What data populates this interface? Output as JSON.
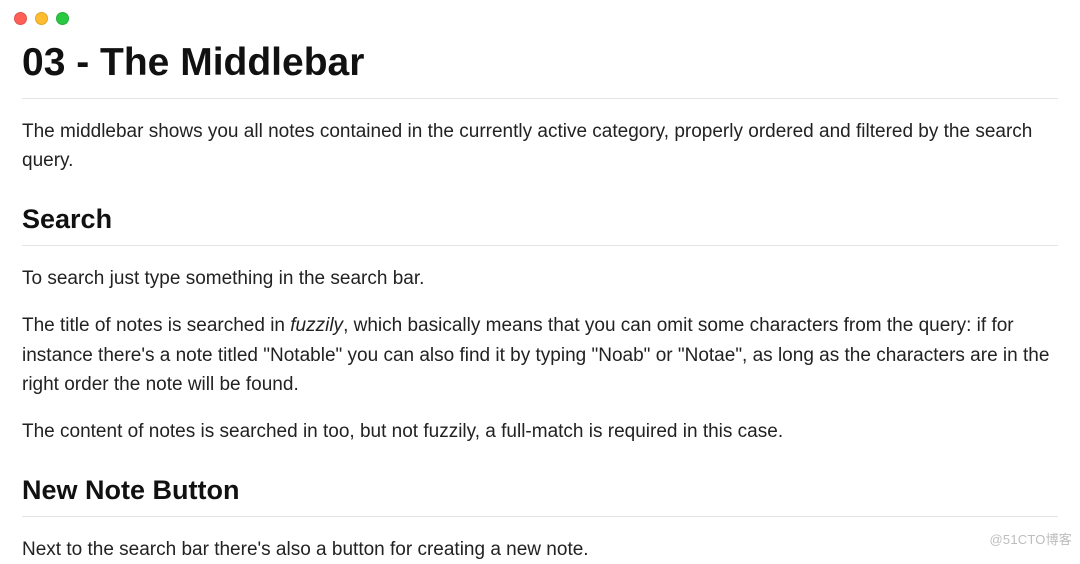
{
  "window": {
    "traffic_lights": {
      "red": "#ff5f57",
      "yellow": "#febc2e",
      "green": "#28c840"
    }
  },
  "document": {
    "title": "03 - The Middlebar",
    "intro": "The middlebar shows you all notes contained in the currently active category, properly ordered and filtered by the search query.",
    "sections": [
      {
        "heading": "Search",
        "paragraphs": [
          "To search just type something in the search bar.",
          {
            "prefix": "The title of notes is searched in ",
            "emphasis": "fuzzily",
            "suffix": ", which basically means that you can omit some characters from the query: if for instance there's a note titled \"Notable\" you can also find it by typing \"Noab\" or \"Notae\", as long as the characters are in the right order the note will be found."
          },
          "The content of notes is searched in too, but not fuzzily, a full-match is required in this case."
        ]
      },
      {
        "heading": "New Note Button",
        "paragraphs": [
          "Next to the search bar there's also a button for creating a new note."
        ]
      }
    ]
  },
  "watermark": "@51CTO博客"
}
